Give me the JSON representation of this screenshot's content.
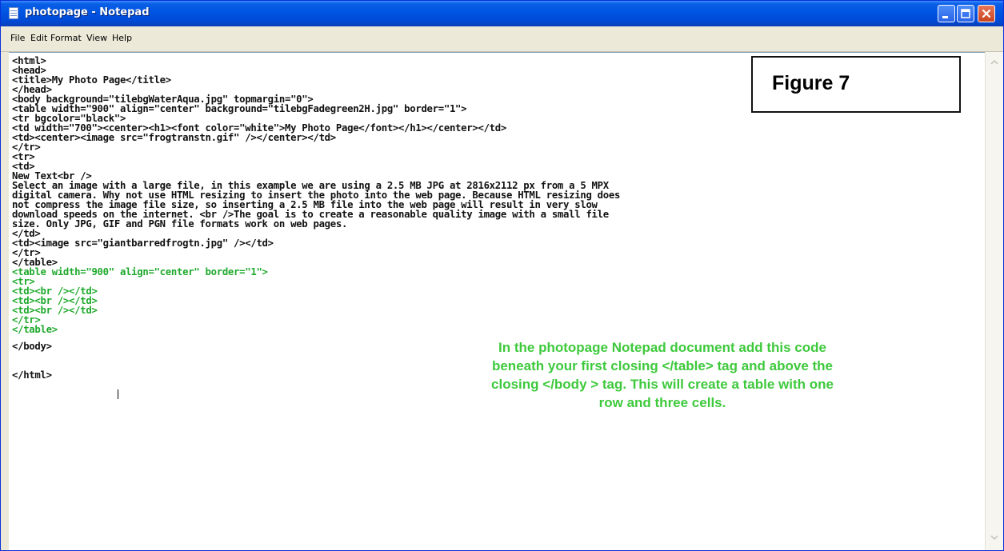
{
  "window": {
    "title": "photopage - Notepad",
    "app_icon": "notepad-icon",
    "controls": {
      "minimize": "minimize-icon",
      "maximize": "maximize-icon",
      "close": "close-icon"
    }
  },
  "menu": {
    "items": [
      "File",
      "Edit",
      "Format",
      "View",
      "Help"
    ]
  },
  "editor": {
    "lines": [
      "<html>",
      "<head>",
      "<title>My Photo Page</title>",
      "</head>",
      "<body background=\"tilebgWaterAqua.jpg\" topmargin=\"0\">",
      "<table width=\"900\" align=\"center\" background=\"tilebgFadegreen2H.jpg\" border=\"1\">",
      "<tr bgcolor=\"black\">",
      "<td width=\"700\"><center><h1><font color=\"white\">My Photo Page</font></h1></center></td>",
      "<td><center><image src=\"frogtranstn.gif\" /></center></td>",
      "</tr>",
      "<tr>",
      "<td>",
      "New Text<br />",
      "Select an image with a large file, in this example we are using a 2.5 MB JPG at 2816x2112 px from a 5 MPX",
      "digital camera. Why not use HTML resizing to insert the photo into the web page. Because HTML resizing does",
      "not compress the image file size, so inserting a 2.5 MB file into the web page will result in very slow",
      "download speeds on the internet. <br />The goal is to create a reasonable quality image with a small file",
      "size. Only JPG, GIF and PGN file formats work on web pages.",
      "</td>",
      "<td><image src=\"giantbarredfrogtn.jpg\" /></td>",
      "</tr>",
      "</table>",
      "<table width=\"900\" align=\"center\" border=\"1\">",
      "<tr>",
      "<td><br /></td>",
      "<td><br /></td>",
      "<td><br /></td>",
      "</tr>",
      "</table>",
      "</body>",
      "</html>"
    ],
    "highlight_color": "#1ea92c"
  },
  "figure_label": "Figure 7",
  "annotation": {
    "lines": [
      "In the photopage Notepad document add this code",
      "beneath your first closing </table> tag and above the",
      "closing </body > tag. This will create a table with one",
      "row and three cells."
    ],
    "color": "#3ec93c"
  },
  "scrollbar": {
    "up": "scroll-up-arrow-icon",
    "down": "scroll-down-arrow-icon"
  }
}
